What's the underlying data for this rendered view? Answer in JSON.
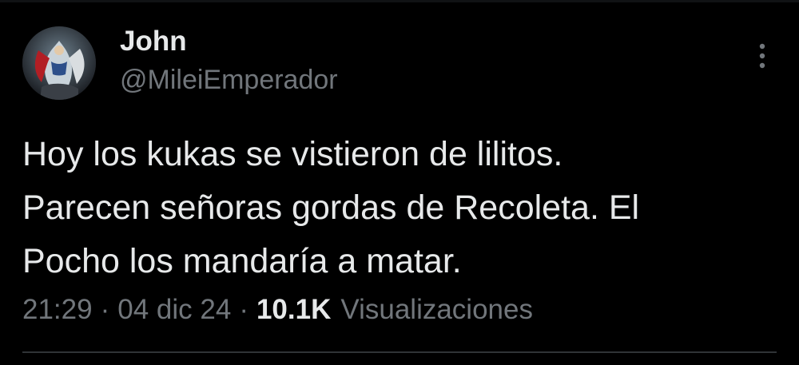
{
  "tweet": {
    "author": {
      "display_name": "John",
      "handle": "@MileiEmperador",
      "avatar_icon": "avatar-image"
    },
    "more_icon": "more-vertical-icon",
    "text": "Hoy los kukas se vistieron de lilitos.\nParecen señoras gordas de Recoleta. El\nPocho los mandaría a matar.",
    "time": "21:29",
    "separator": "·",
    "date": "04 dic 24",
    "views_count": "10.1K",
    "views_label": "Visualizaciones"
  },
  "colors": {
    "background": "#000000",
    "primary_text": "#e7e9ea",
    "secondary_text": "#71767b",
    "divider": "#2f3336"
  }
}
